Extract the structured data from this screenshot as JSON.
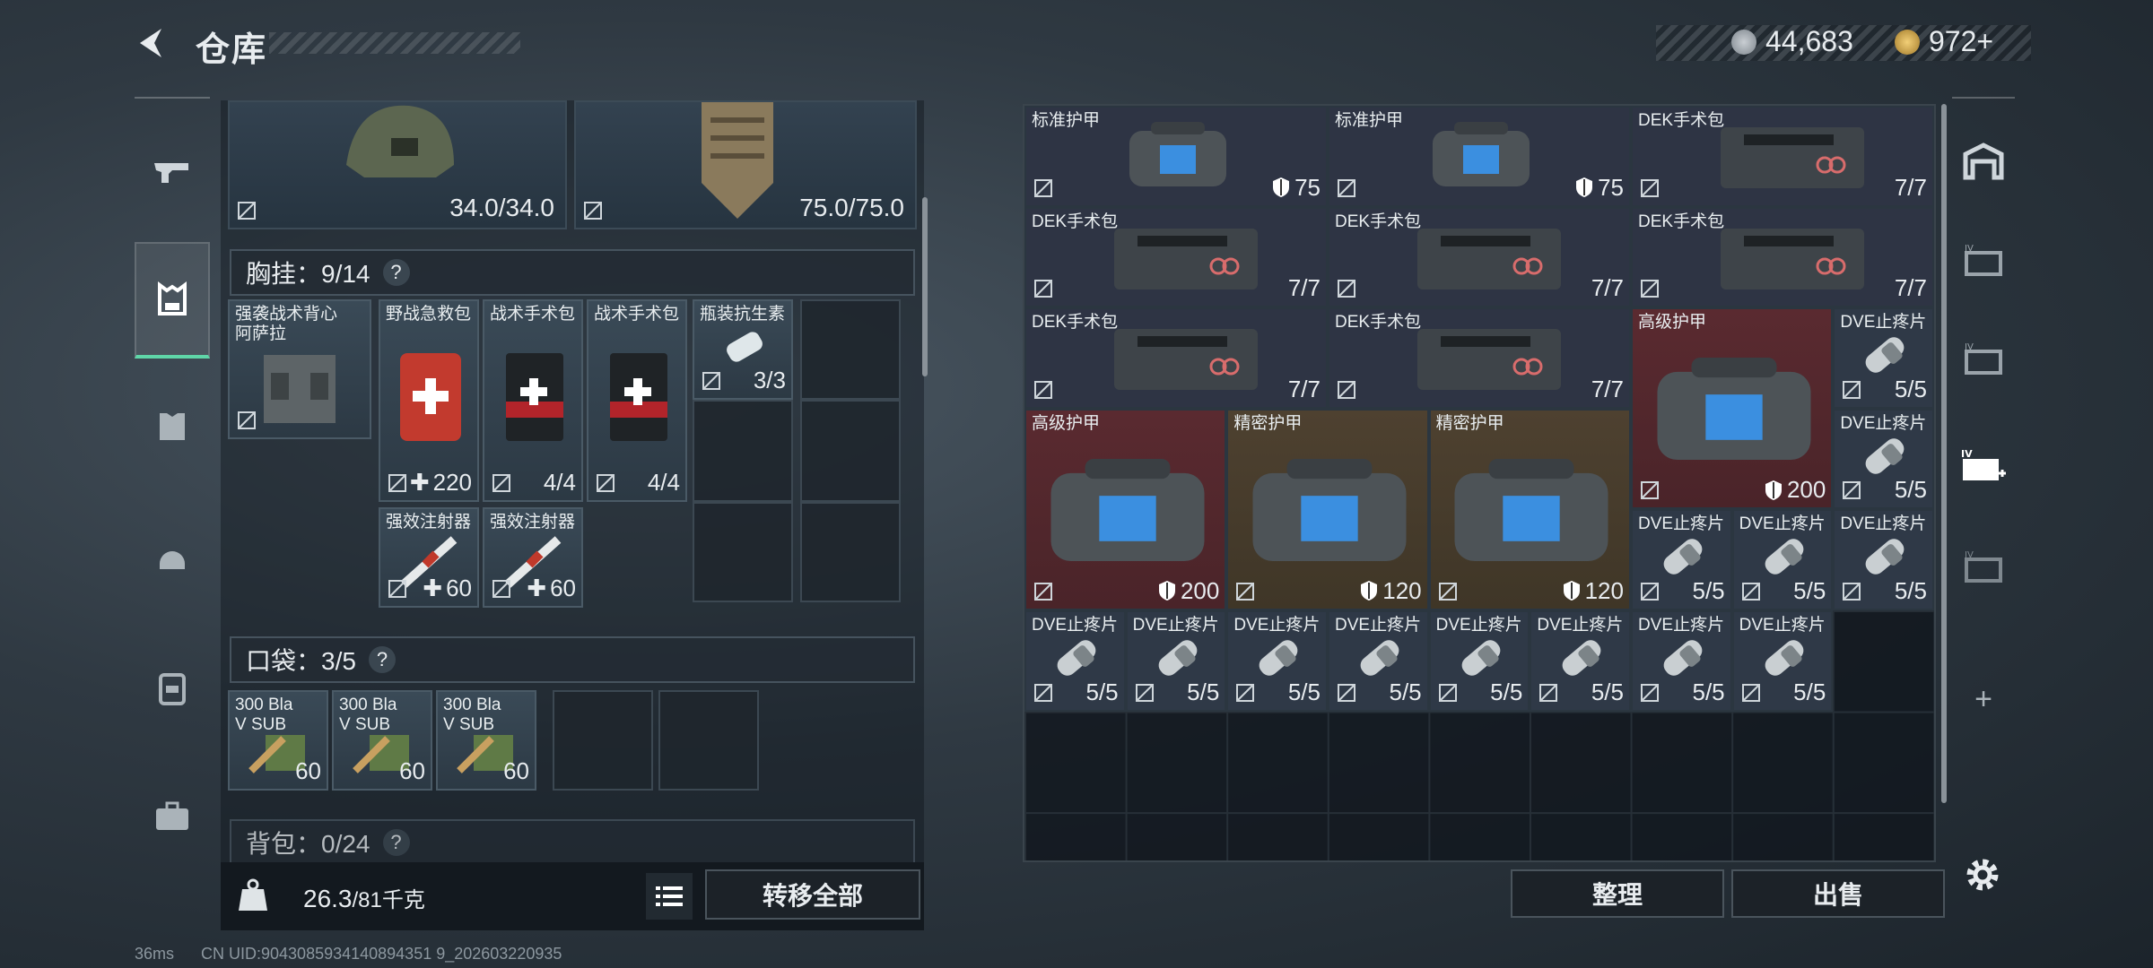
{
  "header": {
    "title": "仓库"
  },
  "currency": {
    "coins": "44,683",
    "premium": "972+"
  },
  "equipment": {
    "helmet_durability": "34.0/34.0",
    "armor_durability": "75.0/75.0"
  },
  "chest_rig": {
    "header": "胸挂：9/14",
    "help": "?",
    "rig_name_line1": "强袭战术背心",
    "rig_name_line2": "阿萨拉",
    "items": [
      {
        "name": "野战急救包",
        "qty": "220",
        "plus": true
      },
      {
        "name": "战术手术包",
        "qty": "4/4"
      },
      {
        "name": "战术手术包",
        "qty": "4/4"
      },
      {
        "name": "瓶装抗生素",
        "qty": "3/3"
      },
      {
        "name": "强效注射器",
        "qty": "60",
        "plus": true
      },
      {
        "name": "强效注射器",
        "qty": "60",
        "plus": true
      }
    ]
  },
  "pockets": {
    "header": "口袋：3/5",
    "help": "?",
    "items": [
      {
        "name_line1": "300 Bla",
        "name_line2": "V SUB",
        "qty": "60"
      },
      {
        "name_line1": "300 Bla",
        "name_line2": "V SUB",
        "qty": "60"
      },
      {
        "name_line1": "300 Bla",
        "name_line2": "V SUB",
        "qty": "60"
      }
    ]
  },
  "backpack": {
    "header": "背包：0/24",
    "help": "?"
  },
  "weight": {
    "current": "26.3",
    "max": "/81千克"
  },
  "buttons": {
    "transfer_all": "转移全部",
    "sort": "整理",
    "sell": "出售"
  },
  "stash": {
    "items": [
      {
        "name": "标准护甲",
        "qty": "75",
        "shield": true,
        "color": "blue"
      },
      {
        "name": "标准护甲",
        "qty": "75",
        "shield": true,
        "color": "blue"
      },
      {
        "name": "DEK手术包",
        "qty": "7/7",
        "color": "blue"
      },
      {
        "name": "DEK手术包",
        "qty": "7/7",
        "color": "blue"
      },
      {
        "name": "DEK手术包",
        "qty": "7/7",
        "color": "blue"
      },
      {
        "name": "DEK手术包",
        "qty": "7/7",
        "color": "blue"
      },
      {
        "name": "DEK手术包",
        "qty": "7/7",
        "color": "blue"
      },
      {
        "name": "DEK手术包",
        "qty": "7/7",
        "color": "blue"
      },
      {
        "name": "高级护甲",
        "qty": "200",
        "shield": true,
        "color": "red"
      },
      {
        "name": "DVE止疼片",
        "qty": "5/5",
        "color": "slate"
      },
      {
        "name": "高级护甲",
        "qty": "200",
        "shield": true,
        "color": "red"
      },
      {
        "name": "精密护甲",
        "qty": "120",
        "shield": true,
        "color": "gold"
      },
      {
        "name": "精密护甲",
        "qty": "120",
        "shield": true,
        "color": "gold"
      },
      {
        "name": "DVE止疼片",
        "qty": "5/5",
        "color": "slate"
      },
      {
        "name": "DVE止疼片",
        "qty": "5/5",
        "color": "slate"
      },
      {
        "name": "DVE止疼片",
        "qty": "5/5",
        "color": "slate"
      },
      {
        "name": "DVE止疼片",
        "qty": "5/5",
        "color": "slate"
      },
      {
        "name": "DVE止疼片",
        "qty": "5/5",
        "color": "slate"
      },
      {
        "name": "DVE止疼片",
        "qty": "5/5",
        "color": "slate"
      },
      {
        "name": "DVE止疼片",
        "qty": "5/5",
        "color": "slate"
      },
      {
        "name": "DVE止疼片",
        "qty": "5/5",
        "color": "slate"
      },
      {
        "name": "DVE止疼片",
        "qty": "5/5",
        "color": "slate"
      },
      {
        "name": "DVE止疼片",
        "qty": "5/5",
        "color": "slate"
      },
      {
        "name": "DVE止疼片",
        "qty": "5/5",
        "color": "slate"
      },
      {
        "name": "DVE止疼片",
        "qty": "5/5",
        "color": "slate"
      }
    ]
  },
  "right_nav": {
    "add": "+"
  },
  "status": {
    "ping": "36ms",
    "uid": "CN UID:9043085934140894351 9_202603220935"
  },
  "colors": {
    "accent": "#5fd6a8",
    "red_item": "#5a2a30",
    "gold_item": "#4e4130",
    "blue_item": "#2e3444"
  }
}
